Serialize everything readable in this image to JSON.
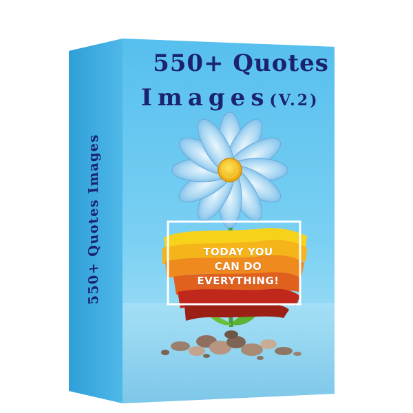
{
  "product": {
    "title_line1": "550+ Quotes",
    "title_line2": "Images",
    "title_version": "(V.2)",
    "spine_text": "550+ Quotes Images",
    "quote_lines": [
      "TODAY YOU",
      "CAN DO",
      "EVERYTHING!"
    ]
  },
  "artwork": {
    "subject": "blue-daisy-flower",
    "icons": [
      "flower-icon",
      "paint-stroke",
      "pebbles"
    ]
  },
  "colors": {
    "box_front": "#5bc3ef",
    "box_spine": "#3aa7de",
    "box_top": "#8ed8f6",
    "title_text": "#1b2270",
    "petals": "#9fd1ef",
    "flower_center": "#f6c21a",
    "paint_yellow": "#f5c518",
    "paint_orange": "#ee7a1c",
    "paint_red": "#c0281c"
  }
}
